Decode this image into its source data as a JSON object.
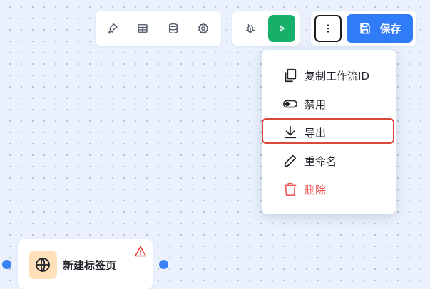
{
  "toolbar": {
    "tools": [
      {
        "icon": "pin-icon"
      },
      {
        "icon": "table-icon"
      },
      {
        "icon": "database-icon"
      },
      {
        "icon": "gear-icon"
      }
    ],
    "debug_icon": "bug-icon",
    "run_icon": "play-icon",
    "run_color": "#16b06b",
    "more_icon": "more-vertical-icon",
    "save_label": "保存",
    "save_color": "#2f7cf6"
  },
  "menu": {
    "items": [
      {
        "label": "复制工作流ID",
        "icon": "copy-icon"
      },
      {
        "label": "禁用",
        "icon": "toggle-icon"
      },
      {
        "label": "导出",
        "icon": "download-icon",
        "highlighted": true
      },
      {
        "label": "重命名",
        "icon": "pencil-icon"
      },
      {
        "label": "删除",
        "icon": "trash-icon",
        "danger": true
      }
    ],
    "danger_color": "#ef5b5b",
    "highlight_color": "#d9483b"
  },
  "node": {
    "title": "新建标签页",
    "icon": "globe-icon",
    "warning_icon": "warning-icon",
    "port_color": "#3b82f6"
  }
}
